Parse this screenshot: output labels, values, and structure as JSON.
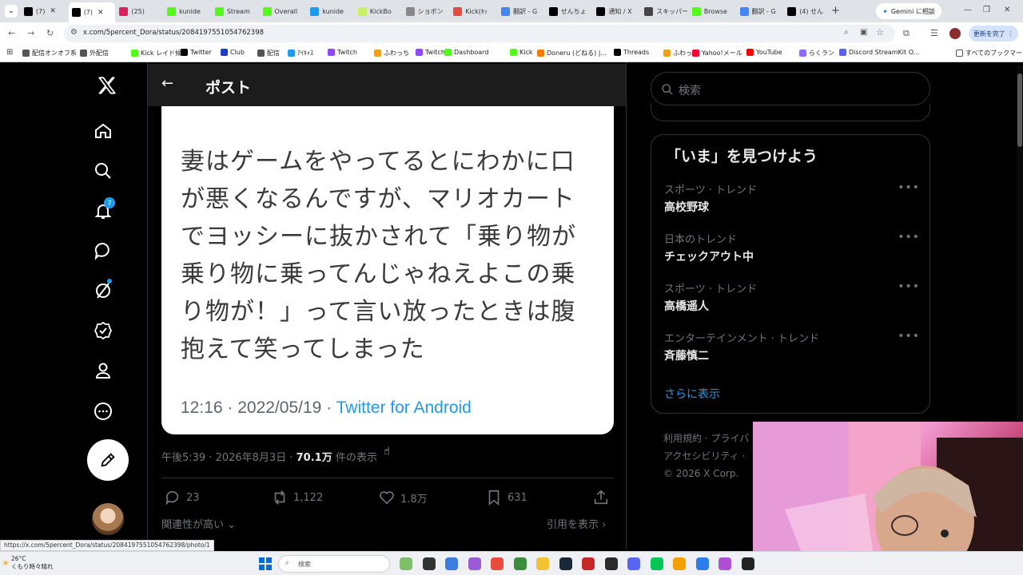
{
  "browser": {
    "tabs": [
      {
        "label": "(7)",
        "color": "#000"
      },
      {
        "label": "(7)",
        "color": "#000",
        "active": true
      },
      {
        "label": "(25)",
        "color": "#e01e5a"
      },
      {
        "label": "kunide",
        "color": "#53fc18"
      },
      {
        "label": "Stream",
        "color": "#53fc18"
      },
      {
        "label": "Overall",
        "color": "#53fc18"
      },
      {
        "label": "kunide",
        "color": "#1d9bf0"
      },
      {
        "label": "KickBo",
        "color": "#c8f064"
      },
      {
        "label": "ショボン",
        "color": "#888888"
      },
      {
        "label": "Kick(ｷｯ",
        "color": "#e84c3d"
      },
      {
        "label": "翻訳 - G",
        "color": "#4285f4"
      },
      {
        "label": "せんちょ",
        "color": "#000"
      },
      {
        "label": "通知 / X",
        "color": "#000"
      },
      {
        "label": "スキッパー",
        "color": "#444"
      },
      {
        "label": "Browse",
        "color": "#53fc18"
      },
      {
        "label": "翻訳 - G",
        "color": "#4285f4"
      },
      {
        "label": "(4) せん",
        "color": "#000"
      }
    ],
    "gemini_label": "Gemini に相談",
    "url": "x.com/5percent_Dora/status/2084197551054762398",
    "update_label": "更新を完了",
    "bookmarks": [
      {
        "label": "配信オンオフ系",
        "color": "#555"
      },
      {
        "label": "外配信",
        "color": "#555"
      },
      {
        "label": "Kick レイド候補",
        "color": "#53fc18"
      },
      {
        "label": "Twitter",
        "color": "#000"
      },
      {
        "label": "Club",
        "color": "#1d3fbf"
      },
      {
        "label": "配信",
        "color": "#555"
      },
      {
        "label": "ｱｲｷｬｽ",
        "color": "#1d9bf0"
      },
      {
        "label": "Twitch",
        "color": "#9146ff"
      },
      {
        "label": "ふわっち",
        "color": "#f0a020"
      },
      {
        "label": "Twitch",
        "color": "#9146ff"
      },
      {
        "label": "Dashboard",
        "color": "#53fc18"
      },
      {
        "label": "Kick",
        "color": "#53fc18"
      },
      {
        "label": "Doneru (どねる) |...",
        "color": "#f57c00"
      },
      {
        "label": "Threads",
        "color": "#000"
      },
      {
        "label": "ふわっち",
        "color": "#f0a020"
      },
      {
        "label": "Yahoo!メール",
        "color": "#ff0033"
      },
      {
        "label": "YouTube",
        "color": "#ff0000"
      },
      {
        "label": "らくラン",
        "color": "#8c6cff"
      },
      {
        "label": "Discord StreamKit O...",
        "color": "#5865f2"
      }
    ],
    "all_bookmarks": "すべてのブックマーク",
    "status_url": "https://x.com/5percent_Dora/status/2084197551054762398/photo/1"
  },
  "nav": {
    "notifications_badge": "7"
  },
  "post": {
    "header_title": "ポスト",
    "quote_lines": [
      "妻はゲームをやってるとにわかに口",
      "が悪くなるんですが、マリオカート",
      "でヨッシーに抜かされて「乗り物が",
      "乗り物に乗ってんじゃねえよこの乗",
      "り物が！」って言い放ったときは腹",
      "抱えて笑ってしまった"
    ],
    "quote_time": "12:16 · 2022/05/19 · ",
    "quote_source": "Twitter for Android",
    "time": "午後5:39 · 2026年8月3日 · ",
    "views": "70.1万",
    "views_suffix": " 件の表示",
    "replies": "23",
    "reposts": "1,122",
    "likes": "1.8万",
    "bookmarks": "631",
    "relevance": "関連性が高い",
    "quotes_link": "引用を表示"
  },
  "sidebar": {
    "search_placeholder": "検索",
    "trends_title": "「いま」を見つけよう",
    "trends": [
      {
        "context": "スポーツ · トレンド",
        "name": "高校野球"
      },
      {
        "context": "日本のトレンド",
        "name": "チェックアウト中"
      },
      {
        "context": "スポーツ · トレンド",
        "name": "高橋遥人"
      },
      {
        "context": "エンターテインメント · トレンド",
        "name": "斉藤慎二"
      }
    ],
    "show_more": "さらに表示",
    "footer_line1": "利用規約 · プライバ",
    "footer_line2": "アクセシビリティ ·",
    "footer_line3": "© 2026 X Corp."
  },
  "taskbar": {
    "temp": "26°C",
    "weather": "くもり時々晴れ",
    "search_placeholder": "検索"
  }
}
